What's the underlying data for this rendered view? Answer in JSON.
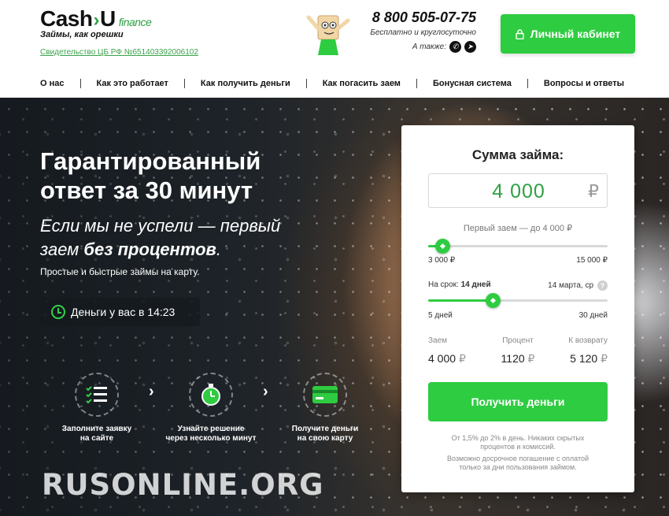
{
  "header": {
    "logo": {
      "cash": "Cash",
      "arrow": "›",
      "u": "U",
      "finance": "finance",
      "tagline": "Займы, как орешки"
    },
    "license": "Свидетельство ЦБ РФ №651403392006102",
    "phone": "8 800 505-07-75",
    "phone_sub": "Бесплатно и круглосуточно",
    "also_label": "А также:",
    "cabinet_button": "Личный кабинет"
  },
  "nav": {
    "items": [
      {
        "label": "О нас"
      },
      {
        "label": "Как это работает"
      },
      {
        "label": "Как получить деньги"
      },
      {
        "label": "Как погасить заем"
      },
      {
        "label": "Бонусная система"
      },
      {
        "label": "Вопросы и ответы"
      }
    ]
  },
  "hero": {
    "title_line1": "Гарантированный",
    "title_line2": "ответ за 30 минут",
    "sub_line1": "Если мы не успели — первый",
    "sub_line2_pre": "заем ",
    "sub_line2_bold": "без процентов",
    "sub_line2_post": ".",
    "small": "Простые и быстрые займы на карту.",
    "timer": "Деньги у вас в 14:23",
    "steps": [
      {
        "line1": "Заполните заявку",
        "line2": "на сайте"
      },
      {
        "line1": "Узнайте решение",
        "line2": "через несколько минут"
      },
      {
        "line1": "Получите деньги",
        "line2": "на свою карту"
      }
    ],
    "watermark": "RUSONLINE.ORG"
  },
  "loan": {
    "title": "Сумма займа:",
    "amount": "4 000",
    "currency": "₽",
    "first_loan_note": "Первый заем — до 4 000 ₽",
    "amount_slider": {
      "min_label": "3 000 ₽",
      "max_label": "15 000 ₽",
      "fraction": 0.08
    },
    "term_label_pre": "На срок: ",
    "term_label_value": "14 дней",
    "term_date": "14 марта, ср",
    "help": "?",
    "term_slider": {
      "min_label": "5 дней",
      "max_label": "30 дней",
      "fraction": 0.36
    },
    "summary": {
      "loan_head": "Заем",
      "loan_val": "4 000",
      "percent_head": "Процент",
      "percent_val": "1120",
      "return_head": "К возврату",
      "return_val": "5 120",
      "cur": "₽"
    },
    "get_button": "Получить деньги",
    "note1_line1": "От 1,5% до 2% в день. Никаких скрытых",
    "note1_line2": "процентов и комиссий.",
    "note2_line1": "Возможно досрочное погашение с оплатой",
    "note2_line2": "только за дни пользования займом."
  },
  "colors": {
    "accent": "#2ecc40",
    "brand_green": "#2ea043"
  }
}
